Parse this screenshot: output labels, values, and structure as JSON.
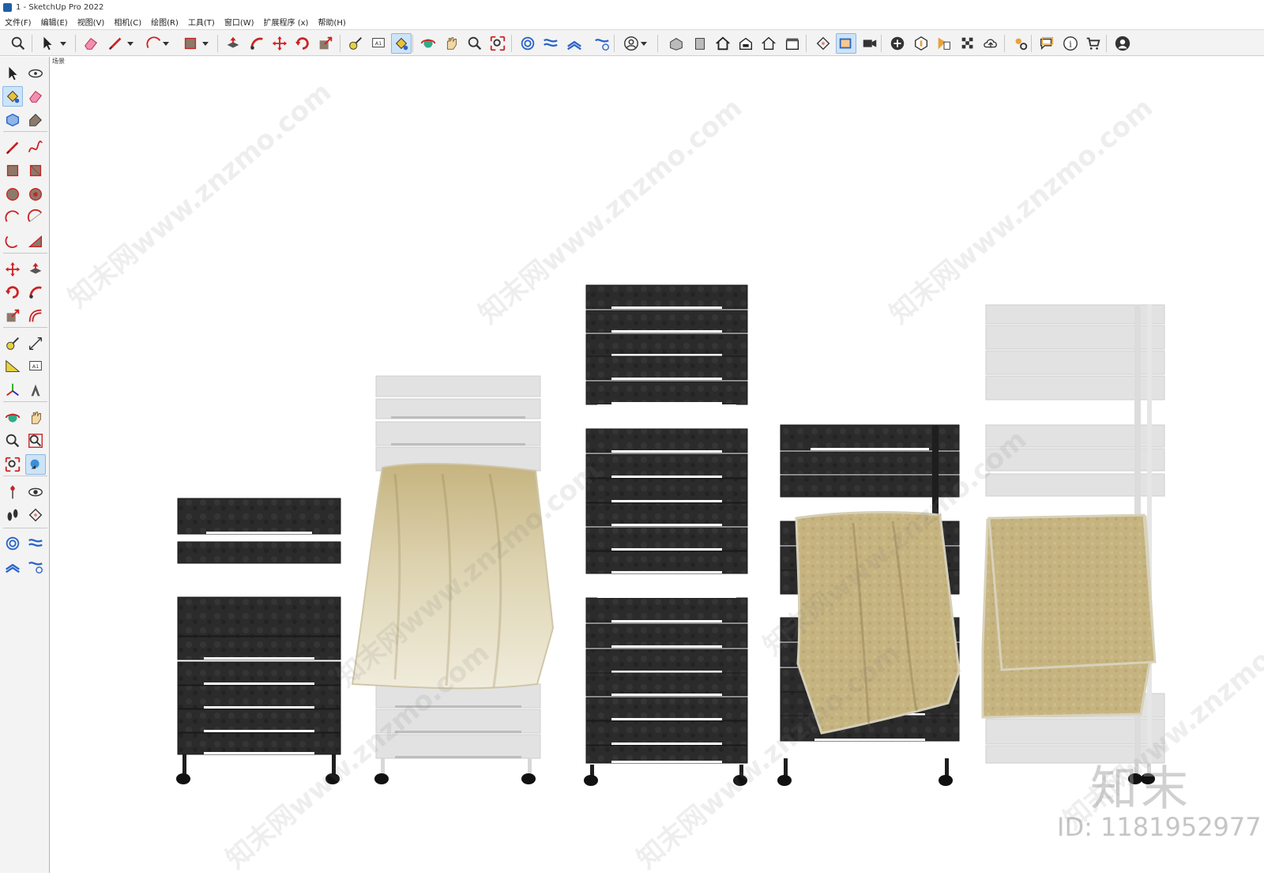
{
  "window": {
    "title": "1 - SketchUp Pro 2022"
  },
  "menu": [
    "文件(F)",
    "编辑(E)",
    "视图(V)",
    "相机(C)",
    "绘图(R)",
    "工具(T)",
    "窗口(W)",
    "扩展程序 (x)",
    "帮助(H)"
  ],
  "scene": {
    "tab_label": "场景"
  },
  "watermark": {
    "site": "知末网www.znzmo.com",
    "logo": "知末",
    "id": "ID: 1181952977"
  },
  "colors": {
    "dark_rail": "#2b2b2b",
    "white_rail": "#e2e2e2",
    "towel_gold": "#c6b480",
    "towel_light": "#ece6cf",
    "toolbar_bg": "#f3f3f3",
    "active_tool": "#cde3f7"
  },
  "top_toolbar_icons": [
    "zoom-tool-icon",
    "select-tool-icon",
    "eraser-icon",
    "pencil-line-icon",
    "arc-icon",
    "rectangle-icon",
    "push-pull-icon",
    "follow-me-icon",
    "move-icon",
    "rotate-icon",
    "scale-icon",
    "tape-measure-icon",
    "text-icon",
    "paint-bucket-icon",
    "orbit-icon",
    "pan-icon",
    "zoom-icon",
    "zoom-extents-icon",
    "sandbox-icon",
    "flip-icon",
    "stack-icon",
    "settings-icon",
    "account-icon",
    "iso-view-icon",
    "front-view-icon",
    "home-view-icon",
    "back-view-icon",
    "house-view-icon",
    "box-view-icon",
    "section-plane-icon",
    "section-display-icon",
    "camera-icon",
    "add-location-icon",
    "geo-icon",
    "styles-icon",
    "checker-icon",
    "cloud-icon",
    "extensions-icon",
    "message-icon",
    "info-icon",
    "cart-icon",
    "profile-icon"
  ],
  "left_toolbar_icons": [
    "select-arrow-icon",
    "orbit-lasso-icon",
    "paint-bucket-icon",
    "eraser-icon",
    "component-icon",
    "tag-icon",
    "pencil-line-icon",
    "freehand-icon",
    "rectangle-icon",
    "rotated-rectangle-icon",
    "circle-icon",
    "polygon-icon",
    "arc-icon",
    "two-point-arc-icon",
    "three-point-arc-icon",
    "pie-icon",
    "move-icon",
    "push-pull-icon",
    "rotate-icon",
    "follow-me-icon",
    "scale-icon",
    "offset-icon",
    "tape-measure-icon",
    "dimension-icon",
    "protractor-icon",
    "text-icon",
    "axes-icon",
    "3d-text-icon",
    "orbit-icon",
    "pan-icon",
    "zoom-icon",
    "zoom-window-icon",
    "zoom-extents-icon",
    "previous-view-icon",
    "position-camera-icon",
    "look-around-icon",
    "walk-icon",
    "section-plane-icon",
    "sandbox-from-contours-icon",
    "sandbox-scratch-icon",
    "smoove-icon",
    "stamp-icon"
  ]
}
